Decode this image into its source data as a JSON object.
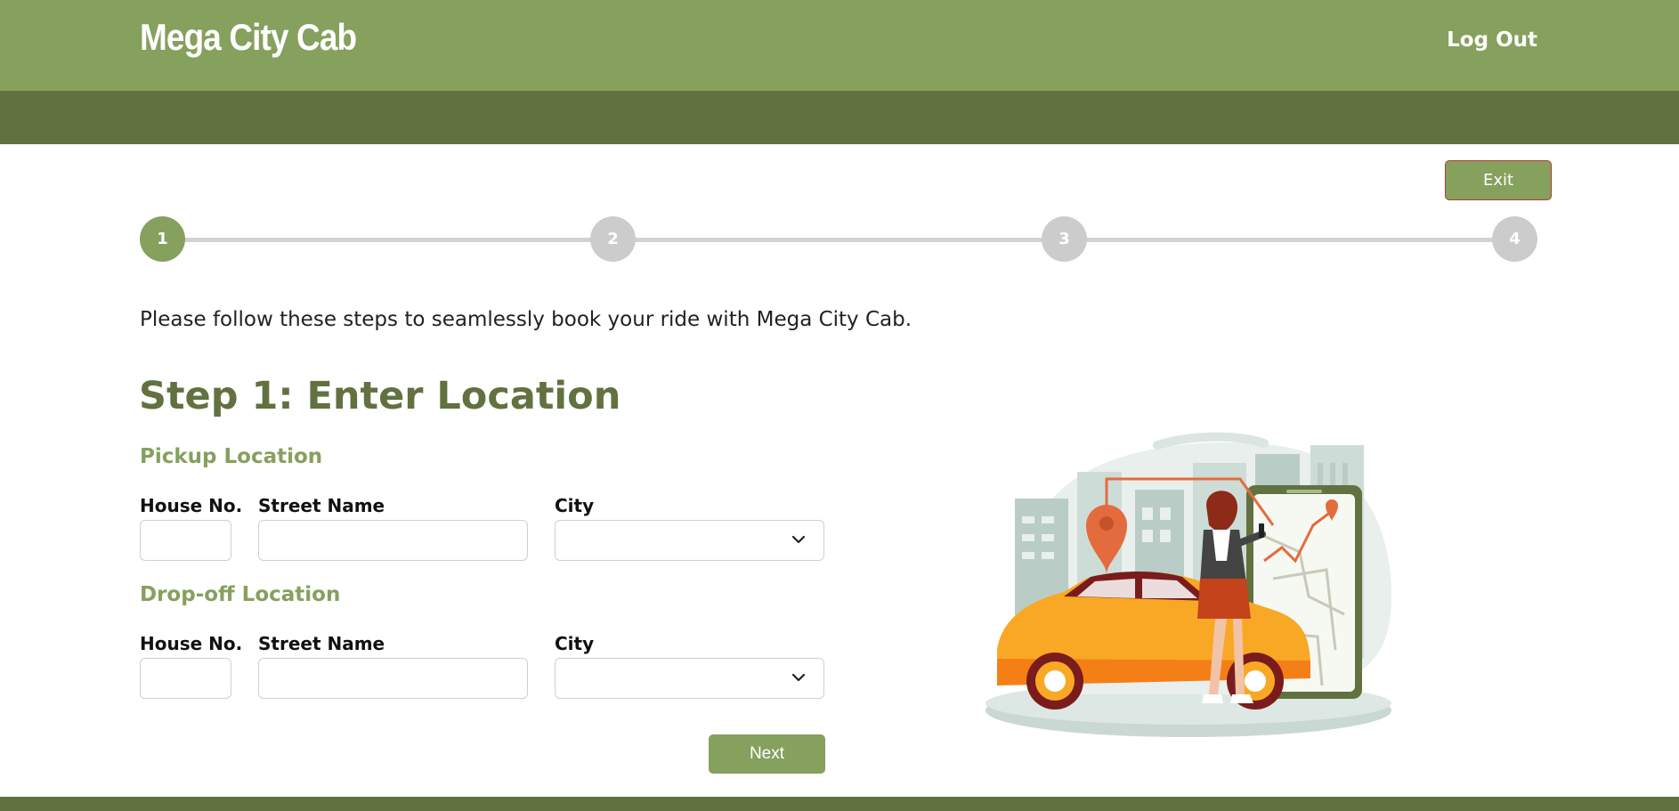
{
  "header": {
    "brand": "Mega City Cab",
    "logout_label": "Log Out"
  },
  "exit_label": "Exit",
  "stepper": {
    "steps": [
      "1",
      "2",
      "3",
      "4"
    ],
    "active_step": 1
  },
  "intro_text": "Please follow these steps to seamlessly book your ride with Mega City Cab.",
  "step_title": "Step 1: Enter Location",
  "pickup": {
    "title": "Pickup Location",
    "house_label": "House No.",
    "street_label": "Street Name",
    "city_label": "City",
    "house_value": "",
    "street_value": "",
    "city_value": ""
  },
  "dropoff": {
    "title": "Drop-off Location",
    "house_label": "House No.",
    "street_label": "Street Name",
    "city_label": "City",
    "house_value": "",
    "street_value": "",
    "city_value": ""
  },
  "next_label": "Next",
  "colors": {
    "primary": "#86a05e",
    "dark": "#627140",
    "inactive": "#cccccc",
    "exit_border": "#b23b2e"
  },
  "icons": {
    "select_chevron": "chevron-down-icon",
    "illustration": "taxi-booking-illustration"
  }
}
